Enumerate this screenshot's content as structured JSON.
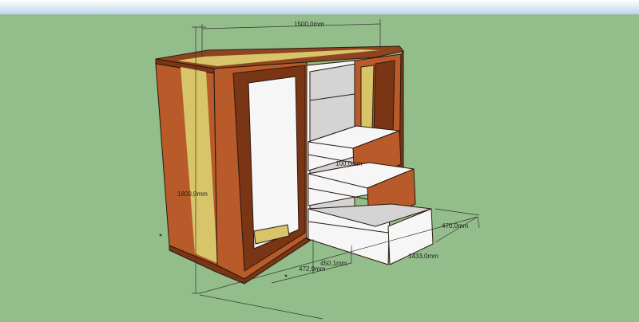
{
  "colors": {
    "sky_top": "#ffffff",
    "sky_bottom": "#bcd4ea",
    "ground": "#93bd8a",
    "wood": "#b85a2a",
    "wood_dark": "#7a3514",
    "wood_top": "#8e4420",
    "inlay": "#d8c56a",
    "white_panel": "#f6f6f6",
    "shadow_panel": "#d4d4d4",
    "edge": "#2a1a10",
    "dimension_line": "#333333"
  },
  "dimensions": {
    "width_top": "1500,0mm",
    "height_left": "1800,0mm",
    "middle_height": "100,0mm",
    "depth_right": "470,0mm",
    "width_bottom": "1433,0mm",
    "bottom_a": "472,9mm",
    "bottom_b": "450,1mm"
  }
}
